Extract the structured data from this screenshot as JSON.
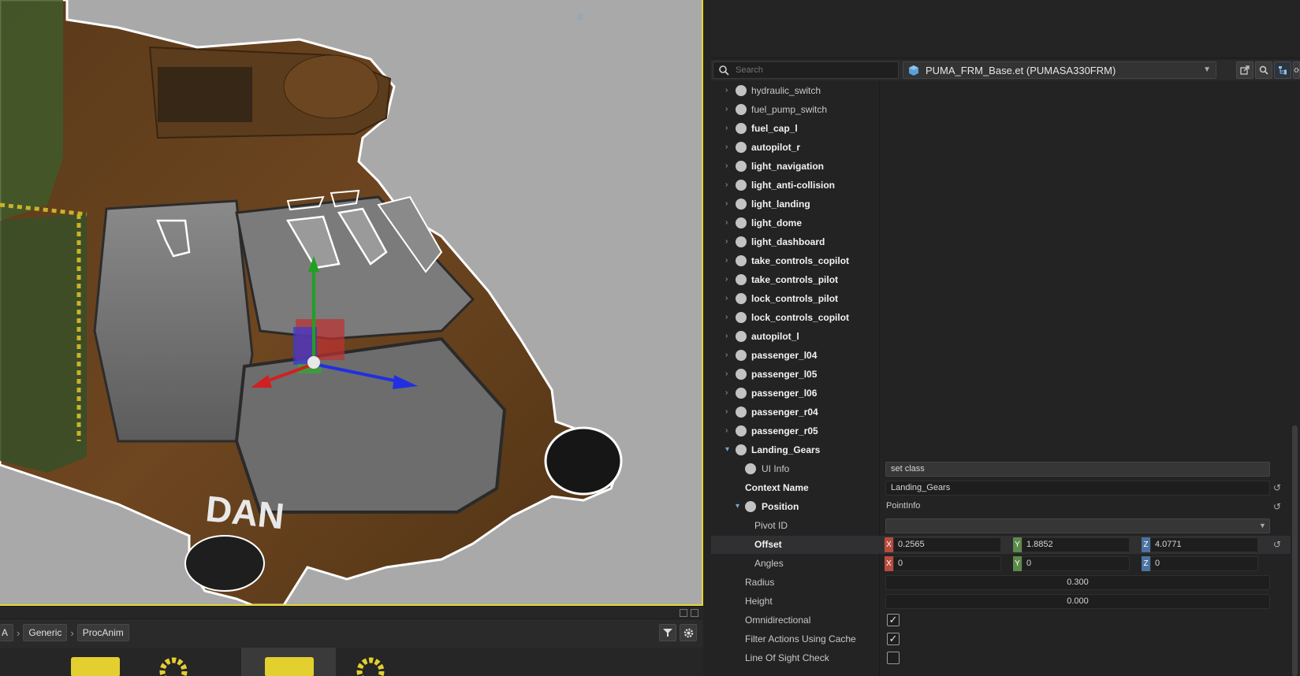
{
  "viewport": {
    "fuselage_text": "DAN",
    "gizmo_label": "Z"
  },
  "asset_browser": {
    "breadcrumb": [
      "A",
      "Generic",
      "ProcAnim"
    ],
    "filter_icon": "filter-icon",
    "settings_icon": "gear-icon"
  },
  "hierarchy": {
    "search_placeholder": "Search",
    "entity_label": "PUMA_FRM_Base.et (PUMASA330FRM)",
    "items": [
      {
        "label": "hydraulic_switch",
        "bold": false
      },
      {
        "label": "fuel_pump_switch",
        "bold": false
      },
      {
        "label": "fuel_cap_l",
        "bold": true
      },
      {
        "label": "autopilot_r",
        "bold": true
      },
      {
        "label": "light_navigation",
        "bold": true
      },
      {
        "label": "light_anti-collision",
        "bold": true
      },
      {
        "label": "light_landing",
        "bold": true
      },
      {
        "label": "light_dome",
        "bold": true
      },
      {
        "label": "light_dashboard",
        "bold": true
      },
      {
        "label": "take_controls_copilot",
        "bold": true
      },
      {
        "label": "take_controls_pilot",
        "bold": true
      },
      {
        "label": "lock_controls_pilot",
        "bold": true
      },
      {
        "label": "lock_controls_copilot",
        "bold": true
      },
      {
        "label": "autopilot_l",
        "bold": true
      },
      {
        "label": "passenger_l04",
        "bold": true
      },
      {
        "label": "passenger_l05",
        "bold": true
      },
      {
        "label": "passenger_l06",
        "bold": true
      },
      {
        "label": "passenger_r04",
        "bold": true
      },
      {
        "label": "passenger_r05",
        "bold": true
      },
      {
        "label": "Landing_Gears",
        "bold": true
      }
    ],
    "ui_info": {
      "label": "UI Info",
      "value": "set class"
    },
    "context_name": {
      "label": "Context Name",
      "value": "Landing_Gears"
    },
    "position": {
      "label": "Position",
      "value": "PointInfo"
    },
    "pivot_id": {
      "label": "Pivot ID",
      "value": ""
    },
    "offset": {
      "label": "Offset",
      "x": "0.2565",
      "y": "1.8852",
      "z": "4.0771"
    },
    "angles": {
      "label": "Angles",
      "x": "0",
      "y": "0",
      "z": "0"
    },
    "radius": {
      "label": "Radius",
      "value": "0.300"
    },
    "height": {
      "label": "Height",
      "value": "0.000"
    },
    "omnidirectional": {
      "label": "Omnidirectional",
      "checked": true
    },
    "filter_actions": {
      "label": "Filter Actions Using Cache",
      "checked": true
    },
    "line_of_sight": {
      "label": "Line Of Sight Check",
      "checked": false
    }
  },
  "colors": {
    "viewport_bg": "#a9a9a9",
    "selection_border": "#e3d432",
    "axis_x": "#b84a3e",
    "axis_y": "#5b8a4a",
    "axis_z": "#4a73a0"
  }
}
